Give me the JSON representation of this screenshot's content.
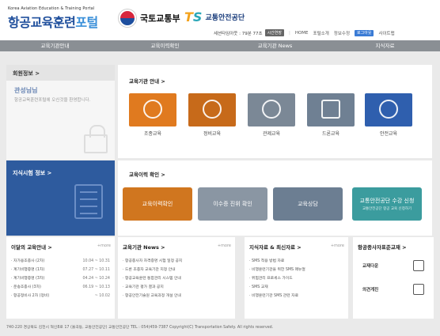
{
  "header": {
    "logo_en": "Korea Aviation Education & Training Portal",
    "logo_ko_a": "항공교육훈련",
    "logo_ko_b": "포털",
    "molit": "국토교통부",
    "ts_mark_a": "T",
    "ts_mark_b": "S",
    "ts_name": "교통안전공단",
    "session": "세션타임아웃 : 79분 77초",
    "extend": "시간연장",
    "links": [
      "HOME",
      "포털소개",
      "정보수정"
    ],
    "logout": "로그아웃",
    "sitemap": "사이트맵"
  },
  "nav": [
    "교육기관안내",
    "교육이력확인",
    "교육기관 News",
    "지식자료"
  ],
  "member": {
    "title": "회원정보",
    "welcome": "관성님님",
    "sub": "항공교육훈련포털에 오신것을 환영합니다."
  },
  "info": {
    "title": "지식시험 정보"
  },
  "edu": {
    "title": "교육기관 안내",
    "tiles": [
      {
        "label": "조종교육",
        "color": "#e07a1f"
      },
      {
        "label": "정비교육",
        "color": "#c76a1a"
      },
      {
        "label": "관제교육",
        "color": "#7b8896"
      },
      {
        "label": "드론교육",
        "color": "#6f8093"
      },
      {
        "label": "안전교육",
        "color": "#2f5fae"
      }
    ]
  },
  "history": {
    "title": "교육이력 확인",
    "buttons": [
      {
        "label": "교육이력확인",
        "sub": "",
        "color": "#d0761f"
      },
      {
        "label": "이수증 진위 확인",
        "sub": "",
        "color": "#8a96a3"
      },
      {
        "label": "교육상담",
        "sub": "",
        "color": "#6c7e92"
      },
      {
        "label": "교통안전공단 수강 신청",
        "sub": "교통안전공단 항공 교육 신청하기",
        "color": "#3b9c9e"
      }
    ]
  },
  "bottom": {
    "more": "+more",
    "schedule": {
      "title": "이달의 교육안내",
      "items": [
        {
          "t": "· 자가용조종사 (2차)",
          "d": "10.04 ~ 10.31"
        },
        {
          "t": "· 계기비행증명 (1차)",
          "d": "07.27 ~ 10.11"
        },
        {
          "t": "· 계기비행증명 (3차)",
          "d": "04.24 ~ 10.24"
        },
        {
          "t": "· 운송조종사 (3차)",
          "d": "06.19 ~ 10.13"
        },
        {
          "t": "· 항공정비사 2차 (정비)",
          "d": "~ 10.02"
        }
      ]
    },
    "news": {
      "title": "교육기관 News",
      "items": [
        "· 항공종사자 자격증명 시험 일정 공지",
        "· 드론 조종자 교육기관 지정 안내",
        "· 항공교육훈련 통합관리 시스템 안내",
        "· 교육기관 평가 결과 공지",
        "· 항공안전기술원 교육과정 개설 안내"
      ]
    },
    "knowledge": {
      "title": "지식자료 & 최신자료",
      "items": [
        "· SMS 적용 방법 자료",
        "· 비행훈련기관을 위한 SMS 매뉴얼",
        "· 위험관리 프로세스 가이드",
        "· SMS 교재",
        "· 비행훈련기관 SMS 관련 자료"
      ]
    },
    "standard": {
      "title": "항공종사자표준교재",
      "items": [
        "교재다운",
        "의견게진"
      ]
    }
  },
  "footer": "740-220 경상북도 김천시 혁신8로 17 (율곡동, 교통안전공단) 교통안전공단 TEL : 054)459-7387 Copyright(C) Transportation Safety. All rights reserved."
}
